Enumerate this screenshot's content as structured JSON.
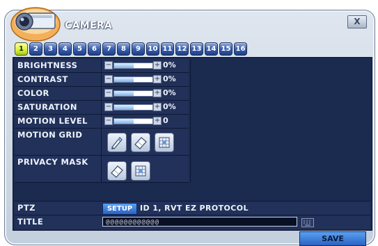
{
  "window": {
    "title": "CAMERA",
    "close_label": "X"
  },
  "tabs": [
    "1",
    "2",
    "3",
    "4",
    "5",
    "6",
    "7",
    "8",
    "9",
    "10",
    "11",
    "12",
    "13",
    "14",
    "15",
    "16"
  ],
  "active_tab": "1",
  "settings": {
    "brightness": {
      "label": "BRIGHTNESS",
      "value": "0%",
      "level": 0.5
    },
    "contrast": {
      "label": "CONTRAST",
      "value": "0%",
      "level": 0.5
    },
    "color": {
      "label": "COLOR",
      "value": "0%",
      "level": 0.5
    },
    "saturation": {
      "label": "SATURATION",
      "value": "0%",
      "level": 0.5
    },
    "motion_level": {
      "label": "MOTION LEVEL",
      "value": "0",
      "level": 0.5
    },
    "motion_grid": {
      "label": "MOTION GRID"
    },
    "privacy_mask": {
      "label": "PRIVACY MASK"
    },
    "ptz": {
      "label": "PTZ",
      "setup_label": "SETUP",
      "info": "ID 1, RVT EZ PROTOCOL"
    },
    "title": {
      "label": "TITLE",
      "value": "@@@@@@@@@@@@"
    }
  },
  "footer": {
    "save_label": "SAVE"
  },
  "icons": {
    "camera": "camera-icon",
    "pencil": "pencil-icon",
    "eraser": "eraser-icon",
    "grid": "grid-select-icon",
    "keyboard": "keyboard-icon"
  },
  "colors": {
    "panel_bg": "#1b2a4f",
    "tab_active": "#d7f03a",
    "tab_inactive": "#3a5fae",
    "button_blue": "#3a7ad8"
  }
}
